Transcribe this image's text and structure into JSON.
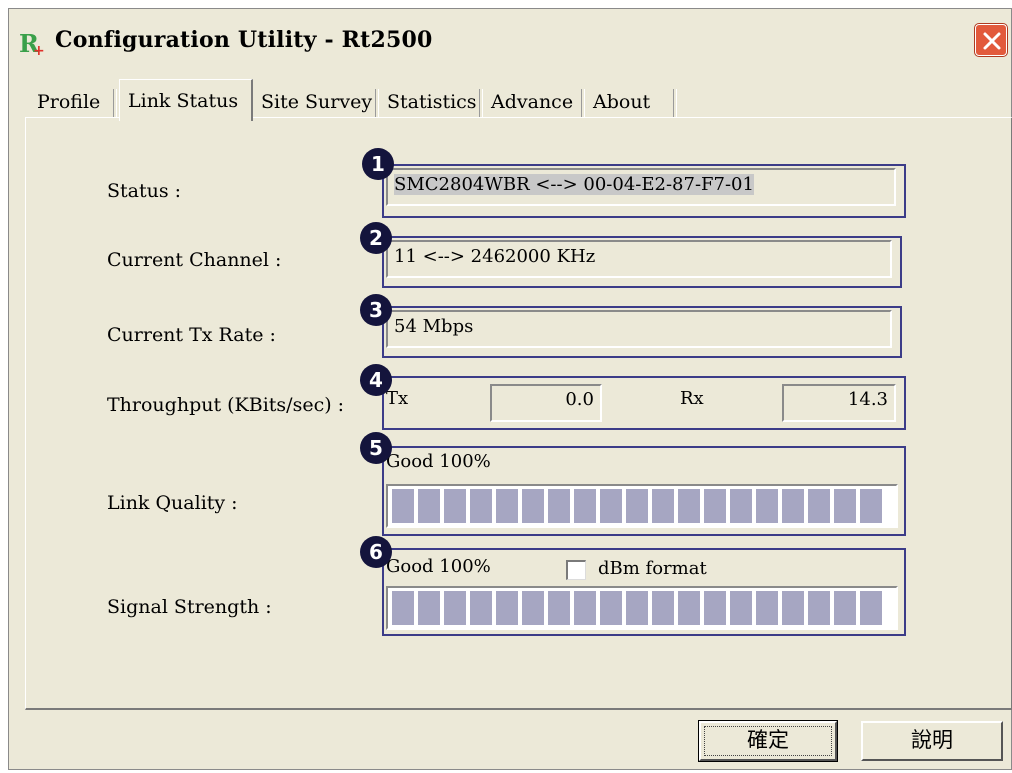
{
  "window": {
    "title": "Configuration Utility - Rt2500",
    "close_icon": "close-icon",
    "app_icon": "ralink-r-icon",
    "accent": "#e25a3c"
  },
  "tabs": [
    {
      "label": "Profile",
      "active": false
    },
    {
      "label": "Link Status",
      "active": true
    },
    {
      "label": "Site Survey",
      "active": false
    },
    {
      "label": "Statistics",
      "active": false
    },
    {
      "label": "Advance",
      "active": false
    },
    {
      "label": "About",
      "active": false
    }
  ],
  "link_status": {
    "status": {
      "label": "Status :",
      "value": "SMC2804WBR <--> 00-04-E2-87-F7-01",
      "badge": "1"
    },
    "channel": {
      "label": "Current Channel :",
      "value": "11 <--> 2462000 KHz",
      "badge": "2"
    },
    "tx_rate": {
      "label": "Current Tx Rate :",
      "value": "54 Mbps",
      "badge": "3"
    },
    "throughput": {
      "label": "Throughput (KBits/sec) :",
      "badge": "4",
      "tx_label": "Tx",
      "tx_value": "0.0",
      "rx_label": "Rx",
      "rx_value": "14.3"
    },
    "link_quality": {
      "label": "Link Quality :",
      "badge": "5",
      "text": "Good 100%",
      "percent": 100
    },
    "signal_strength": {
      "label": "Signal Strength :",
      "badge": "6",
      "text": "Good 100%",
      "percent": 100,
      "dbm_label": "dBm format",
      "dbm_checked": false
    }
  },
  "buttons": {
    "ok": "確定",
    "help": "說明"
  },
  "colors": {
    "group_border": "#3c3c88",
    "meter_segment": "#a6a6c2",
    "badge": "#14143c"
  }
}
